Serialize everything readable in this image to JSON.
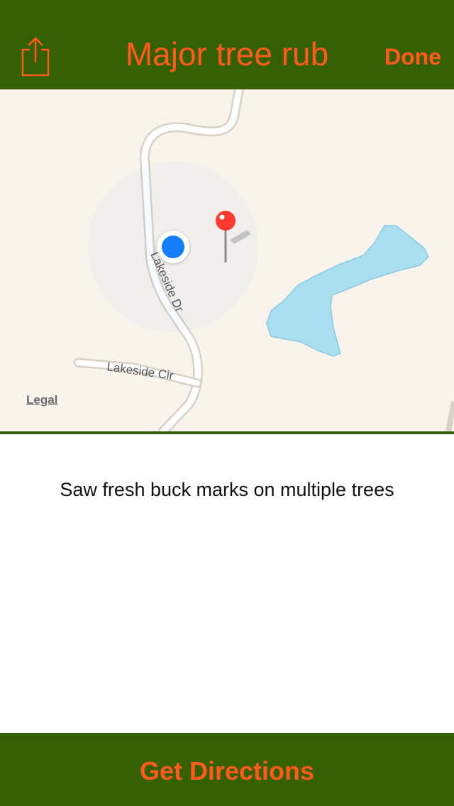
{
  "nav": {
    "title": "Major tree rub",
    "done_label": "Done",
    "share_icon": "share-icon"
  },
  "map": {
    "road_labels": [
      "Lakeside Dr",
      "Lakeside Cir"
    ],
    "legal_label": "Legal",
    "pin_color": "#ff3b30",
    "user_location_color": "#157efb",
    "water_color": "#aadff0"
  },
  "note": {
    "text": "Saw fresh buck marks on multiple trees"
  },
  "footer": {
    "directions_label": "Get Directions"
  },
  "colors": {
    "bar_green": "#356104",
    "accent_orange": "#ff5a1a"
  }
}
